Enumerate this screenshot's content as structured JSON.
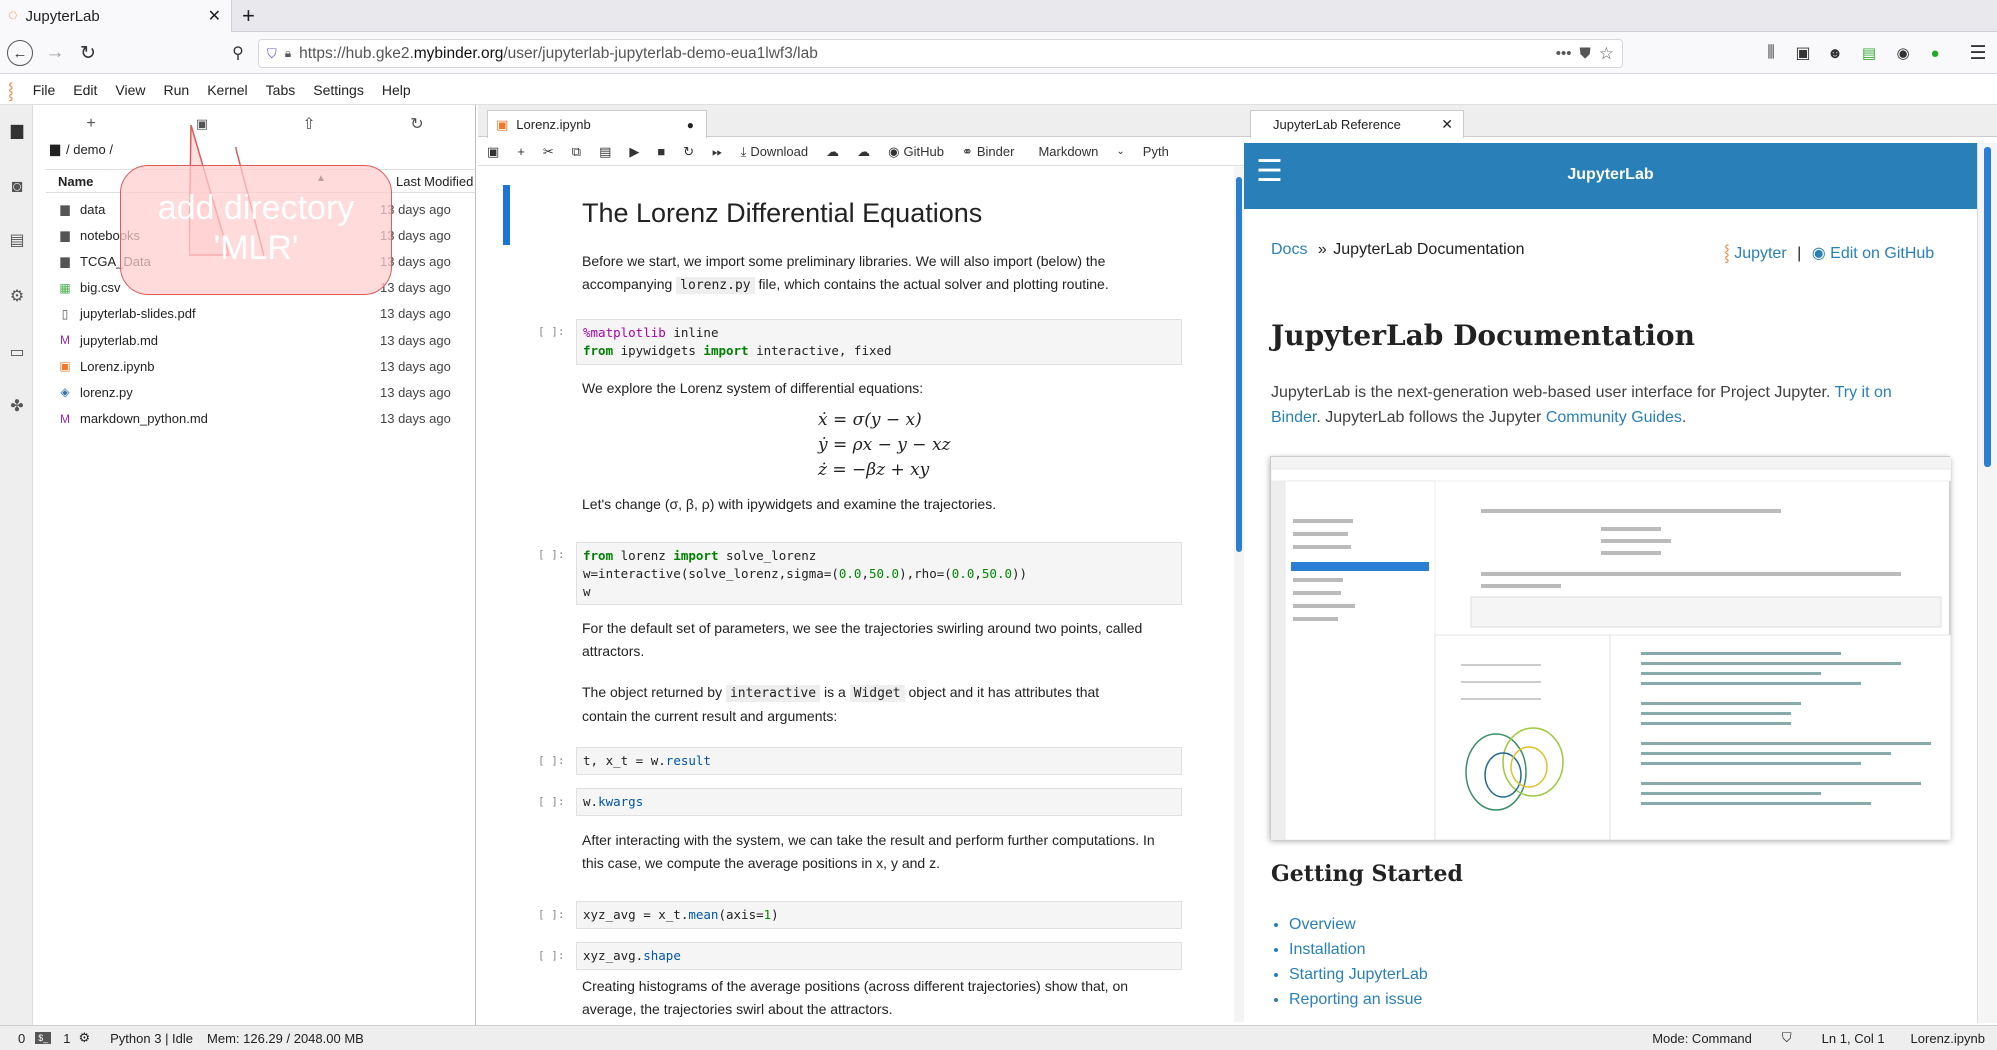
{
  "browser": {
    "tab_title": "JupyterLab",
    "url_prefix": "https://hub.gke2.",
    "url_domain": "mybinder.org",
    "url_path": "/user/jupyterlab-jupyterlab-demo-eua1lwf3/lab"
  },
  "menu": [
    "File",
    "Edit",
    "View",
    "Run",
    "Kernel",
    "Tabs",
    "Settings",
    "Help"
  ],
  "filebrowser": {
    "breadcrumb": "/ demo /",
    "col_name": "Name",
    "col_modified": "Last Modified",
    "files": [
      {
        "name": "data",
        "modified": "13 days ago",
        "icon": "folder-icon"
      },
      {
        "name": "notebooks",
        "modified": "13 days ago",
        "icon": "folder-icon"
      },
      {
        "name": "TCGA_Data",
        "modified": "13 days ago",
        "icon": "folder-icon"
      },
      {
        "name": "big.csv",
        "modified": "13 days ago",
        "icon": "spreadsheet-icon"
      },
      {
        "name": "jupyterlab-slides.pdf",
        "modified": "13 days ago",
        "icon": "file-icon"
      },
      {
        "name": "jupyterlab.md",
        "modified": "13 days ago",
        "icon": "markdown-icon"
      },
      {
        "name": "Lorenz.ipynb",
        "modified": "13 days ago",
        "icon": "notebook-icon"
      },
      {
        "name": "lorenz.py",
        "modified": "13 days ago",
        "icon": "python-icon"
      },
      {
        "name": "markdown_python.md",
        "modified": "13 days ago",
        "icon": "markdown-icon"
      }
    ]
  },
  "callout": {
    "line1": "add directory",
    "line2": "'MLR'"
  },
  "notebook": {
    "tab_title": "Lorenz.ipynb",
    "toolbar": {
      "download": "Download",
      "github": "GitHub",
      "binder": "Binder",
      "cell_type": "Markdown",
      "kernel": "Pyth"
    },
    "heading": "The Lorenz Differential Equations",
    "p1a": "Before we start, we import some preliminary libraries. We will also import (below) the",
    "p1b_pre": "accompanying",
    "p1b_code": "lorenz.py",
    "p1b_post": "file, which contains the actual solver and plotting routine.",
    "prompt": "[ ]:",
    "p2": "We explore the Lorenz system of differential equations:",
    "eq1": "ẋ = σ(y − x)",
    "eq2": "ẏ = ρx − y − xz",
    "eq3": "ż = −βz + xy",
    "p3": "Let's change (σ, β, ρ) with ipywidgets and examine the trajectories.",
    "p4a": "For the default set of parameters, we see the trajectories swirling around two points, called",
    "p4b": "attractors.",
    "p5a_pre": "The object returned by",
    "p5a_code1": "interactive",
    "p5a_mid": "is a",
    "p5a_code2": "Widget",
    "p5a_post": "object and it has attributes that",
    "p5b": "contain the current result and arguments:",
    "p6a": "After interacting with the system, we can take the result and perform further computations. In",
    "p6b": "this case, we compute the average positions in x, y and z.",
    "p7a": "Creating histograms of the average positions (across different trajectories) show that, on",
    "p7b": "average, the trajectories swirl about the attractors."
  },
  "reference": {
    "tab_title": "JupyterLab Reference",
    "header": "JupyterLab",
    "crumb_docs": "Docs",
    "crumb_sep": "»",
    "crumb_page": "JupyterLab Documentation",
    "jupyter_link": "Jupyter",
    "sep": "|",
    "github_link": "Edit on GitHub",
    "title": "JupyterLab Documentation",
    "intro_a": "JupyterLab is the next-generation web-based user interface for Project Jupyter.",
    "intro_link1": "Try it on",
    "intro_link1b": "Binder",
    "intro_b": ". JupyterLab follows the Jupyter",
    "intro_link2": "Community Guides",
    "intro_end": ".",
    "getting_started": "Getting Started",
    "links": [
      "Overview",
      "Installation",
      "Starting JupyterLab",
      "Reporting an issue"
    ]
  },
  "status": {
    "zero": "0",
    "one": "1",
    "kernel": "Python 3 | Idle",
    "mem": "Mem: 126.29 / 2048.00 MB",
    "mode": "Mode: Command",
    "pos": "Ln 1, Col 1",
    "file": "Lorenz.ipynb"
  },
  "colors": {
    "accent": "#2980b9",
    "jupyter_orange": "#f37726",
    "cell_bar": "#1976d2"
  }
}
